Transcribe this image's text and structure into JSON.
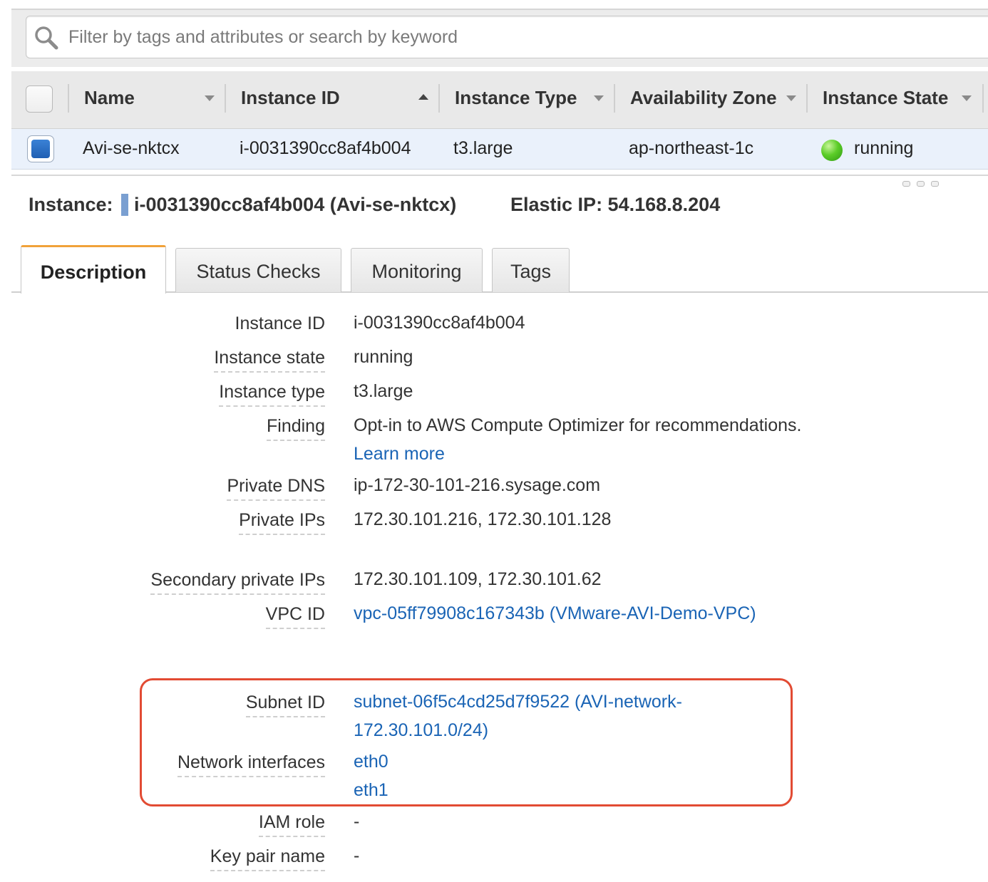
{
  "search": {
    "placeholder": "Filter by tags and attributes or search by keyword"
  },
  "table": {
    "columns": [
      {
        "label": "Name",
        "sort": "caret-down"
      },
      {
        "label": "Instance ID",
        "sort": "caret-up"
      },
      {
        "label": "Instance Type",
        "sort": "caret-down"
      },
      {
        "label": "Availability Zone",
        "sort": "caret-down"
      },
      {
        "label": "Instance State",
        "sort": "caret-down"
      }
    ],
    "row": {
      "name": "Avi-se-nktcx",
      "instance_id": "i-0031390cc8af4b004",
      "instance_type": "t3.large",
      "availability_zone": "ap-northeast-1c",
      "instance_state": "running",
      "state_color": "#4cbb1f"
    }
  },
  "detail": {
    "instance_label": "Instance:",
    "instance_value": "i-0031390cc8af4b004 (Avi-se-nktcx)",
    "elastic_ip": "Elastic IP: 54.168.8.204"
  },
  "tabs": [
    "Description",
    "Status Checks",
    "Monitoring",
    "Tags"
  ],
  "description": {
    "instance_id": {
      "label": "Instance ID",
      "value": "i-0031390cc8af4b004"
    },
    "instance_state": {
      "label": "Instance state",
      "value": "running"
    },
    "instance_type": {
      "label": "Instance type",
      "value": "t3.large"
    },
    "finding": {
      "label": "Finding",
      "value": "Opt-in to AWS Compute Optimizer for recommendations.",
      "link": "Learn more"
    },
    "private_dns": {
      "label": "Private DNS",
      "value": "ip-172-30-101-216.sysage.com"
    },
    "private_ips": {
      "label": "Private IPs",
      "value": "172.30.101.216, 172.30.101.128"
    },
    "secondary_private_ips": {
      "label": "Secondary private IPs",
      "value": "172.30.101.109, 172.30.101.62"
    },
    "vpc_id": {
      "label": "VPC ID",
      "value": "vpc-05ff79908c167343b (VMware-AVI-Demo-VPC)"
    },
    "subnet_id": {
      "label": "Subnet ID",
      "value_line1": "subnet-06f5c4cd25d7f9522 (AVI-network-",
      "value_line2": "172.30.101.0/24)"
    },
    "network_interfaces": {
      "label": "Network interfaces",
      "values": [
        "eth0",
        "eth1"
      ]
    },
    "iam_role": {
      "label": "IAM role",
      "value": "-"
    },
    "key_pair_name": {
      "label": "Key pair name",
      "value": "-"
    }
  },
  "colors": {
    "link": "#1a64b5",
    "tab_accent": "#f1a23a",
    "highlight": "#e24b33",
    "selected_row": "#eaf1fb"
  }
}
